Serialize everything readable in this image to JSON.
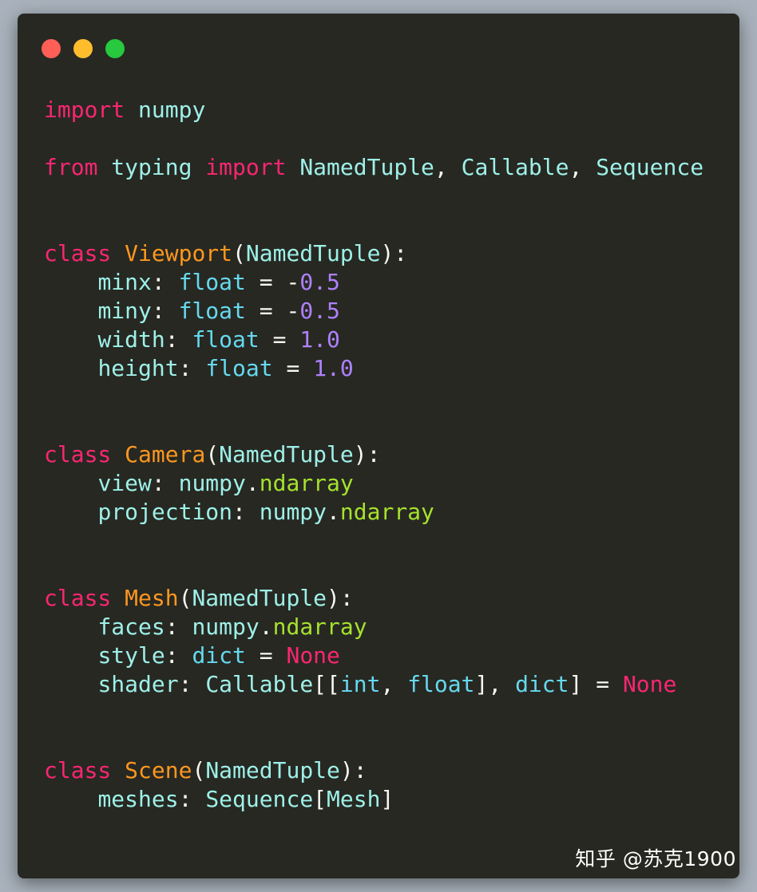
{
  "window_controls": [
    {
      "name": "close",
      "color": "#ff5f56"
    },
    {
      "name": "minimize",
      "color": "#ffbd2e"
    },
    {
      "name": "maximize",
      "color": "#27c93f"
    }
  ],
  "colors": {
    "background": "#272822",
    "default": "#f8f8f2",
    "keyword": "#f92672",
    "class_name": "#fd971f",
    "identifier": "#9ef0e8",
    "builtin_type": "#66d9ef",
    "number": "#ae81ff",
    "attribute": "#a6e22e"
  },
  "code_lines": [
    [
      [
        "import",
        "keyword"
      ],
      [
        " ",
        "default"
      ],
      [
        "numpy",
        "identifier"
      ]
    ],
    [],
    [
      [
        "from",
        "keyword"
      ],
      [
        " ",
        "default"
      ],
      [
        "typing",
        "identifier"
      ],
      [
        " ",
        "default"
      ],
      [
        "import",
        "keyword"
      ],
      [
        " ",
        "default"
      ],
      [
        "NamedTuple",
        "identifier"
      ],
      [
        ", ",
        "default"
      ],
      [
        "Callable",
        "identifier"
      ],
      [
        ", ",
        "default"
      ],
      [
        "Sequence",
        "identifier"
      ]
    ],
    [],
    [],
    [
      [
        "class",
        "keyword"
      ],
      [
        " ",
        "default"
      ],
      [
        "Viewport",
        "class_name"
      ],
      [
        "(",
        "default"
      ],
      [
        "NamedTuple",
        "identifier"
      ],
      [
        "):",
        "default"
      ]
    ],
    [
      [
        "    ",
        "default"
      ],
      [
        "minx",
        "identifier"
      ],
      [
        ": ",
        "default"
      ],
      [
        "float",
        "builtin_type"
      ],
      [
        " = -",
        "default"
      ],
      [
        "0.5",
        "number"
      ]
    ],
    [
      [
        "    ",
        "default"
      ],
      [
        "miny",
        "identifier"
      ],
      [
        ": ",
        "default"
      ],
      [
        "float",
        "builtin_type"
      ],
      [
        " = -",
        "default"
      ],
      [
        "0.5",
        "number"
      ]
    ],
    [
      [
        "    ",
        "default"
      ],
      [
        "width",
        "identifier"
      ],
      [
        ": ",
        "default"
      ],
      [
        "float",
        "builtin_type"
      ],
      [
        " = ",
        "default"
      ],
      [
        "1.0",
        "number"
      ]
    ],
    [
      [
        "    ",
        "default"
      ],
      [
        "height",
        "identifier"
      ],
      [
        ": ",
        "default"
      ],
      [
        "float",
        "builtin_type"
      ],
      [
        " = ",
        "default"
      ],
      [
        "1.0",
        "number"
      ]
    ],
    [],
    [],
    [
      [
        "class",
        "keyword"
      ],
      [
        " ",
        "default"
      ],
      [
        "Camera",
        "class_name"
      ],
      [
        "(",
        "default"
      ],
      [
        "NamedTuple",
        "identifier"
      ],
      [
        "):",
        "default"
      ]
    ],
    [
      [
        "    ",
        "default"
      ],
      [
        "view",
        "identifier"
      ],
      [
        ": ",
        "default"
      ],
      [
        "numpy",
        "identifier"
      ],
      [
        ".",
        "default"
      ],
      [
        "ndarray",
        "attribute"
      ]
    ],
    [
      [
        "    ",
        "default"
      ],
      [
        "projection",
        "identifier"
      ],
      [
        ": ",
        "default"
      ],
      [
        "numpy",
        "identifier"
      ],
      [
        ".",
        "default"
      ],
      [
        "ndarray",
        "attribute"
      ]
    ],
    [],
    [],
    [
      [
        "class",
        "keyword"
      ],
      [
        " ",
        "default"
      ],
      [
        "Mesh",
        "class_name"
      ],
      [
        "(",
        "default"
      ],
      [
        "NamedTuple",
        "identifier"
      ],
      [
        "):",
        "default"
      ]
    ],
    [
      [
        "    ",
        "default"
      ],
      [
        "faces",
        "identifier"
      ],
      [
        ": ",
        "default"
      ],
      [
        "numpy",
        "identifier"
      ],
      [
        ".",
        "default"
      ],
      [
        "ndarray",
        "attribute"
      ]
    ],
    [
      [
        "    ",
        "default"
      ],
      [
        "style",
        "identifier"
      ],
      [
        ": ",
        "default"
      ],
      [
        "dict",
        "builtin_type"
      ],
      [
        " = ",
        "default"
      ],
      [
        "None",
        "keyword"
      ]
    ],
    [
      [
        "    ",
        "default"
      ],
      [
        "shader",
        "identifier"
      ],
      [
        ": ",
        "default"
      ],
      [
        "Callable",
        "identifier"
      ],
      [
        "[[",
        "default"
      ],
      [
        "int",
        "builtin_type"
      ],
      [
        ", ",
        "default"
      ],
      [
        "float",
        "builtin_type"
      ],
      [
        "], ",
        "default"
      ],
      [
        "dict",
        "builtin_type"
      ],
      [
        "] = ",
        "default"
      ],
      [
        "None",
        "keyword"
      ]
    ],
    [],
    [],
    [
      [
        "class",
        "keyword"
      ],
      [
        " ",
        "default"
      ],
      [
        "Scene",
        "class_name"
      ],
      [
        "(",
        "default"
      ],
      [
        "NamedTuple",
        "identifier"
      ],
      [
        "):",
        "default"
      ]
    ],
    [
      [
        "    ",
        "default"
      ],
      [
        "meshes",
        "identifier"
      ],
      [
        ": ",
        "default"
      ],
      [
        "Sequence",
        "identifier"
      ],
      [
        "[",
        "default"
      ],
      [
        "Mesh",
        "identifier"
      ],
      [
        "]",
        "default"
      ]
    ]
  ],
  "watermark": "知乎 @苏克1900"
}
